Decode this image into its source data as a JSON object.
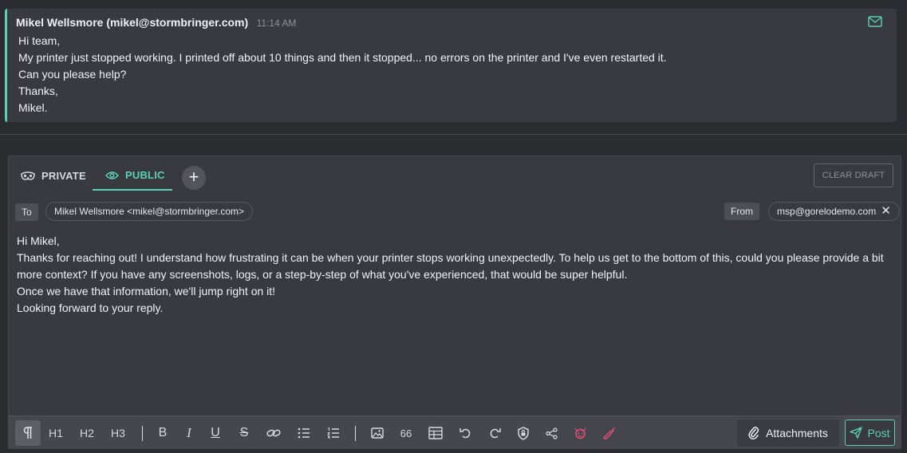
{
  "message": {
    "author": "Mikel Wellsmore (mikel@stormbringer.com)",
    "time": "11:14 AM",
    "icon": "mail-icon",
    "lines": [
      "Hi team,",
      "My printer just stopped working. I printed off about 10 things and then it stopped... no errors on the printer and I've even restarted it.",
      "Can you please help?",
      "Thanks,",
      "Mikel."
    ]
  },
  "composer": {
    "tabs": {
      "private": "PRIVATE",
      "public": "PUBLIC"
    },
    "active_tab": "public",
    "add_tab": "+",
    "clear_draft": "CLEAR DRAFT",
    "to_label": "To",
    "to_value": "Mikel Wellsmore <mikel@stormbringer.com>",
    "from_label": "From",
    "from_value": "msp@gorelodemo.com",
    "from_remove": "✕",
    "body": [
      "Hi Mikel,",
      "Thanks for reaching out! I understand how frustrating it can be when your printer stops working unexpectedly. To help us get to the bottom of this, could you please provide a bit more context? If you have any screenshots, logs, or a step-by-step of what you've experienced, that would be super helpful.",
      "Once we have that information, we'll jump right on it!",
      "Looking forward to your reply."
    ]
  },
  "toolbar": {
    "h1": "H1",
    "h2": "H2",
    "h3": "H3",
    "bold": "B",
    "italic": "I",
    "underline": "U",
    "strike": "S",
    "quote": "66",
    "attachments": "Attachments",
    "post": "Post"
  },
  "colors": {
    "accent": "#5ad1b4",
    "ai": "#e8507a"
  }
}
